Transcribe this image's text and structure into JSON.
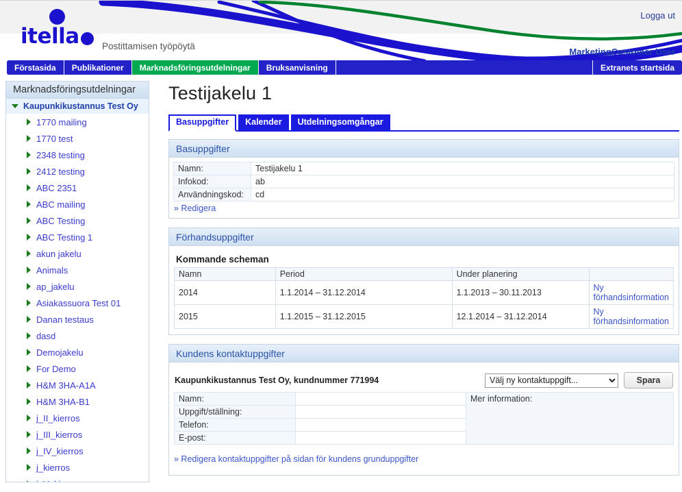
{
  "header": {
    "logo_text": "itella",
    "tagline": "Postittamisen työpöytä",
    "logout_label": "Logga ut",
    "user_name": "MarketingCustomer User",
    "brand_blue": "#1a12cc",
    "brand_green": "#00a84f"
  },
  "nav": {
    "items": [
      {
        "label": "Förstasida",
        "active": false
      },
      {
        "label": "Publikationer",
        "active": false
      },
      {
        "label": "Marknadsföringsutdelningar",
        "active": true
      },
      {
        "label": "Bruksanvisning",
        "active": false
      }
    ],
    "right_item": "Extranets startsida"
  },
  "sidebar": {
    "title": "Marknadsföringsutdelningar",
    "root": {
      "label": "Kaupunkikustannus Test Oy",
      "expanded": true
    },
    "items": [
      {
        "label": "1770 mailing"
      },
      {
        "label": "1770 test"
      },
      {
        "label": "2348 testing"
      },
      {
        "label": "2412 testing"
      },
      {
        "label": "ABC 2351"
      },
      {
        "label": "ABC mailing"
      },
      {
        "label": "ABC Testing"
      },
      {
        "label": "ABC Testing 1"
      },
      {
        "label": "akun jakelu"
      },
      {
        "label": "Animals"
      },
      {
        "label": "ap_jakelu"
      },
      {
        "label": "Asiakassuora Test 01"
      },
      {
        "label": "Danan testaus"
      },
      {
        "label": "dasd"
      },
      {
        "label": "Demojakelu"
      },
      {
        "label": "For Demo"
      },
      {
        "label": "H&M 3HA-A1A"
      },
      {
        "label": "H&M 3HA-B1"
      },
      {
        "label": "j_II_kierros"
      },
      {
        "label": "j_III_kierros"
      },
      {
        "label": "j_IV_kierros"
      },
      {
        "label": "j_kierros"
      },
      {
        "label": "j_V_kierros"
      }
    ]
  },
  "main": {
    "page_title": "Testijakelu 1",
    "tabs": [
      {
        "label": "Basuppgifter",
        "active": true
      },
      {
        "label": "Kalender",
        "active": false
      },
      {
        "label": "Utdelningsomgångar",
        "active": false
      }
    ],
    "basic": {
      "panel_title": "Basuppgifter",
      "rows": [
        {
          "key": "Namn:",
          "value": "Testijakelu 1"
        },
        {
          "key": "Infokod:",
          "value": "ab"
        },
        {
          "key": "Användningskod:",
          "value": "cd"
        }
      ],
      "edit_link": "» Redigera"
    },
    "advance": {
      "panel_title": "Förhandsuppgifter",
      "subtitle": "Kommande scheman",
      "columns": [
        "Namn",
        "Period",
        "Under planering",
        ""
      ],
      "rows": [
        {
          "namn": "2014",
          "period": "1.1.2014 – 31.12.2014",
          "planering": "1.1.2013 – 30.11.2013",
          "action": "Ny förhandsinformation"
        },
        {
          "namn": "2015",
          "period": "1.1.2015 – 31.12.2015",
          "planering": "12.1.2014 – 31.12.2014",
          "action": "Ny förhandsinformation"
        }
      ]
    },
    "contact": {
      "panel_title": "Kundens kontaktuppgifter",
      "customer_line": "Kaupunkikustannus Test Oy, kundnummer 771994",
      "select_value": "Välj ny kontaktuppgift...",
      "save_label": "Spara",
      "more_info_label": "Mer information:",
      "rows": [
        {
          "label": "Namn:",
          "value": ""
        },
        {
          "label": "Uppgift/ställning:",
          "value": ""
        },
        {
          "label": "Telefon:",
          "value": ""
        },
        {
          "label": "E-post:",
          "value": ""
        }
      ],
      "footer_link": "» Redigera kontaktuppgifter på sidan för kundens grunduppgifter"
    }
  }
}
